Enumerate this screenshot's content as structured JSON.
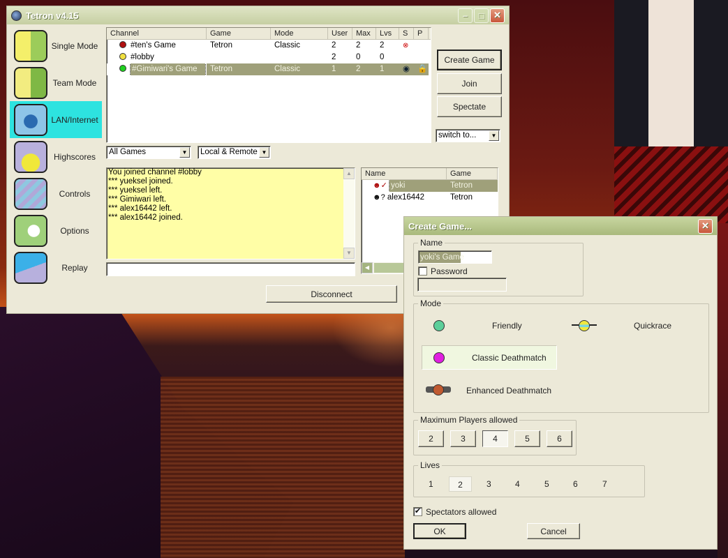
{
  "main_window": {
    "title": "Tetron v4.15",
    "sidebar": [
      {
        "label": "Single Mode",
        "icon": "single-mode-icon",
        "active": false
      },
      {
        "label": "Team Mode",
        "icon": "team-mode-icon",
        "active": false
      },
      {
        "label": "LAN/Internet",
        "icon": "globe-icon",
        "active": true
      },
      {
        "label": "Highscores",
        "icon": "highscores-icon",
        "active": false
      },
      {
        "label": "Controls",
        "icon": "controls-icon",
        "active": false
      },
      {
        "label": "Options",
        "icon": "options-icon",
        "active": false
      },
      {
        "label": "Replay",
        "icon": "replay-icon",
        "active": false
      }
    ],
    "channels": {
      "headers": [
        "Channel",
        "Game",
        "Mode",
        "User",
        "Max",
        "Lvs",
        "S",
        "P"
      ],
      "rows": [
        {
          "status_color": "#b01010",
          "channel": "#ten's Game",
          "game": "Tetron",
          "mode": "Classic",
          "user": "2",
          "max": "2",
          "lvs": "2",
          "spectate": "no-spectate-icon",
          "private": "",
          "selected": false
        },
        {
          "status_color": "#f0e040",
          "channel": "#lobby",
          "game": "",
          "mode": "",
          "user": "2",
          "max": "0",
          "lvs": "0",
          "spectate": "",
          "private": "",
          "selected": false
        },
        {
          "status_color": "#20d020",
          "channel": "#Gimiwari's Game",
          "game": "Tetron",
          "mode": "Classic",
          "user": "1",
          "max": "2",
          "lvs": "1",
          "spectate": "eye-icon",
          "private": "lock-icon",
          "selected": true
        }
      ]
    },
    "buttons": {
      "create_game": "Create Game",
      "join": "Join",
      "spectate": "Spectate",
      "disconnect": "Disconnect"
    },
    "switch_to": "switch to...",
    "filter_games": "All Games",
    "filter_location": "Local & Remote",
    "chat_log": [
      "You joined channel #lobby",
      "*** yueksel joined.",
      "*** yueksel left.",
      "*** Gimiwari left.",
      "*** alex16442 left.",
      "*** alex16442 joined."
    ],
    "chat_input": "",
    "users": {
      "headers": [
        "Name",
        "Game"
      ],
      "rows": [
        {
          "name": "yoki",
          "game": "Tetron",
          "selected": true
        },
        {
          "name": "alex16442",
          "game": "Tetron",
          "selected": false
        }
      ]
    }
  },
  "dialog": {
    "title": "Create Game...",
    "name_group": "Name",
    "name_value": "yoki's Game",
    "password_label": "Password",
    "password_checked": false,
    "password_value": "",
    "mode_group": "Mode",
    "modes": [
      {
        "label": "Friendly",
        "color": "#5ccf9a",
        "selected": false
      },
      {
        "label": "Quickrace",
        "color": "#7ad7e0",
        "selected": false
      },
      {
        "label": "Classic Deathmatch",
        "color": "#e020e0",
        "selected": true
      },
      {
        "label": "Enhanced Deathmatch",
        "color": "#c05a30",
        "selected": false
      }
    ],
    "max_players_group": "Maximum Players allowed",
    "max_players": [
      "2",
      "3",
      "4",
      "5",
      "6"
    ],
    "max_players_selected": "4",
    "lives_group": "Lives",
    "lives": [
      "1",
      "2",
      "3",
      "4",
      "5",
      "6",
      "7"
    ],
    "lives_selected": "2",
    "spectators_label": "Spectators allowed",
    "spectators_checked": true,
    "ok": "OK",
    "cancel": "Cancel"
  }
}
